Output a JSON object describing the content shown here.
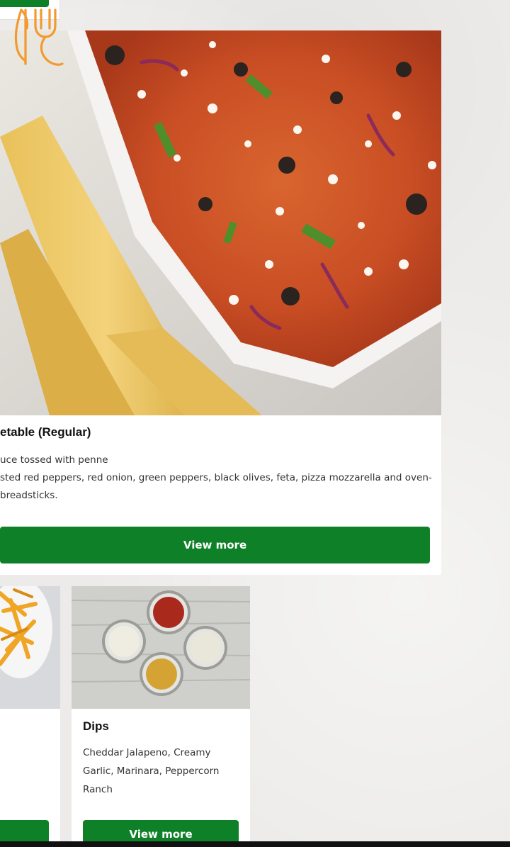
{
  "top_card": {
    "button_label": ""
  },
  "featured": {
    "title": "etable (Regular)",
    "description_lines": [
      "uce tossed with penne",
      "sted red peppers, red onion, green peppers, black olives, feta, pizza mozzarella and oven-",
      "breadsticks."
    ],
    "button_label": "View more"
  },
  "fries_card": {
    "button_label": ""
  },
  "dips_card": {
    "title": "Dips",
    "description_lines": [
      "Cheddar Jalapeno, Creamy",
      "Garlic, Marinara, Peppercorn",
      "Ranch"
    ],
    "button_label": "View more"
  },
  "icons": {
    "logo": "fork-leaf-icon"
  },
  "colors": {
    "accent_green": "#0e8027",
    "logo_orange": "#f29a2e"
  }
}
